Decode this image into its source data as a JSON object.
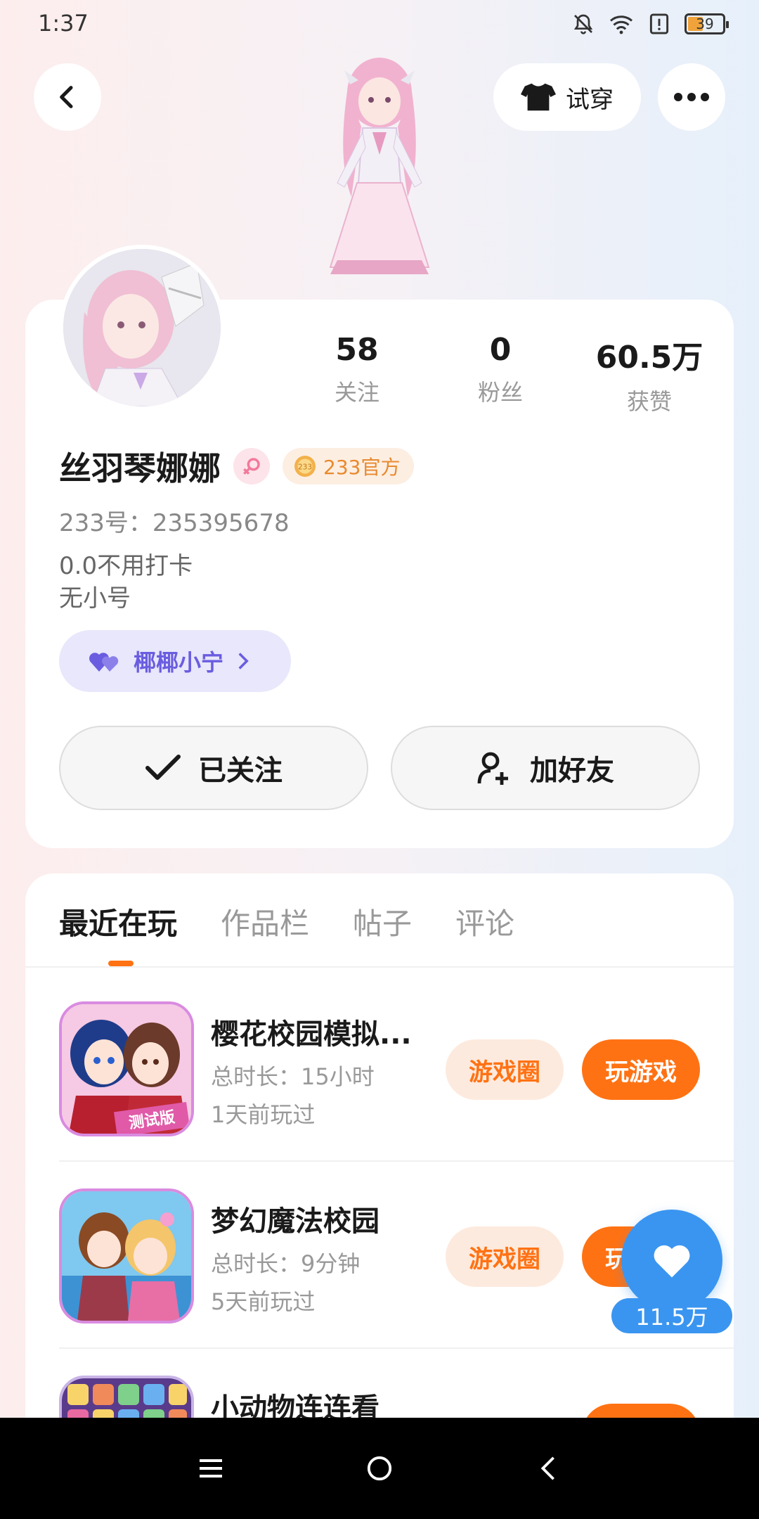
{
  "status_bar": {
    "time": "1:37",
    "battery": "39"
  },
  "header": {
    "tryon_label": "试穿"
  },
  "profile": {
    "stats": [
      {
        "value": "58",
        "label": "关注"
      },
      {
        "value": "0",
        "label": "粉丝"
      },
      {
        "value": "60.5万",
        "label": "获赞"
      }
    ],
    "name": "丝羽琴娜娜",
    "official_badge": "233官方",
    "uid": "233号：235395678",
    "signature_line1": "0.0不用打卡",
    "signature_line2": "无小号",
    "cp_name": "椰椰小宁",
    "follow_label": "已关注",
    "add_friend_label": "加好友"
  },
  "tabs": [
    "最近在玩",
    "作品栏",
    "帖子",
    "评论"
  ],
  "games": [
    {
      "name": "樱花校园模拟...",
      "duration": "总时长：15小时",
      "last_played": "1天前玩过",
      "circle_label": "游戏圈",
      "play_label": "玩游戏",
      "icon_badge": "测试版"
    },
    {
      "name": "梦幻魔法校园",
      "duration": "总时长：9分钟",
      "last_played": "5天前玩过",
      "circle_label": "游戏圈",
      "play_label": "玩游戏"
    },
    {
      "name": "小动物连连看"
    }
  ],
  "like_fab": {
    "count": "11.5万"
  },
  "colors": {
    "accent": "#ff7213",
    "like_blue": "#3a95f0",
    "cp_purple": "#6a5de0"
  }
}
